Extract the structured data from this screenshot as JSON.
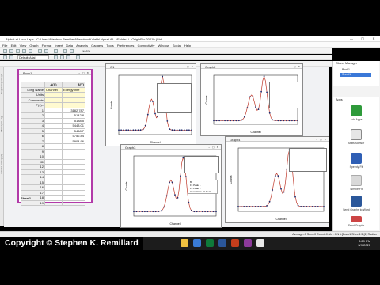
{
  "window": {
    "title": "Alphat at Luna Lapx - C:\\Users\\Stephen Remillard\\Dropbox\\Kolakh\\Alphat.Al\\ - /Folder1/ - OriginPro 2021b (Std)",
    "minimize": "—",
    "maximize": "▢",
    "close": "✕"
  },
  "menu": [
    "File",
    "Edit",
    "View",
    "Graph",
    "Format",
    "Insert",
    "Data",
    "Analysis",
    "Gadgets",
    "Tools",
    "Preferences",
    "Connectivity",
    "Window",
    "Social",
    "Help"
  ],
  "toolbar": {
    "font_label": "Default: Arial",
    "zoom": "100%"
  },
  "left_dock": [
    "Project Explorer (1)",
    "Messages Log",
    "Smart Hint Log (1)"
  ],
  "workbook": {
    "name": "Book1",
    "sheet_tab": "Sheet1",
    "columns": [
      {
        "name": "A(X)"
      },
      {
        "name": "B(Y)"
      }
    ],
    "header_rows": [
      {
        "label": "Long Name",
        "a": "Channel",
        "b": "Energy Inte"
      },
      {
        "label": "Units",
        "a": "",
        "b": ""
      },
      {
        "label": "Comments",
        "a": "",
        "b": ""
      },
      {
        "label": "F(x)=",
        "a": "",
        "b": ""
      }
    ],
    "rows": [
      {
        "n": "1",
        "a": "",
        "b": "3182.787"
      },
      {
        "n": "2",
        "a": "",
        "b": "5142.8"
      },
      {
        "n": "3",
        "a": "",
        "b": "5188.5"
      },
      {
        "n": "4",
        "a": "",
        "b": "5443.01"
      },
      {
        "n": "5",
        "a": "",
        "b": "5468.7"
      },
      {
        "n": "6",
        "a": "",
        "b": "5752.84"
      },
      {
        "n": "7",
        "a": "",
        "b": "5904.96"
      },
      {
        "n": "8",
        "a": "",
        "b": ""
      },
      {
        "n": "9",
        "a": "",
        "b": ""
      },
      {
        "n": "10",
        "a": "",
        "b": ""
      },
      {
        "n": "11",
        "a": "",
        "b": ""
      },
      {
        "n": "12",
        "a": "",
        "b": ""
      },
      {
        "n": "13",
        "a": "",
        "b": ""
      },
      {
        "n": "14",
        "a": "",
        "b": ""
      },
      {
        "n": "15",
        "a": "",
        "b": ""
      },
      {
        "n": "16",
        "a": "",
        "b": ""
      },
      {
        "n": "17",
        "a": "",
        "b": ""
      },
      {
        "n": "18",
        "a": "",
        "b": ""
      },
      {
        "n": "19",
        "a": "",
        "b": ""
      }
    ]
  },
  "graphs": [
    {
      "name": "G1",
      "xlabel": "Channel",
      "ylabel": "Counts",
      "color": "#c0392b"
    },
    {
      "name": "Graph2",
      "xlabel": "Channel",
      "ylabel": "Counts",
      "color": "#2c3e9b"
    },
    {
      "name": "Graph3",
      "xlabel": "Channel",
      "ylabel": "Counts",
      "color": "#2c3e9b",
      "legend": [
        "B",
        "Fit Peak 1",
        "Fit Peak 2",
        "Cumulative Fit Peak"
      ]
    },
    {
      "name": "Graph4",
      "xlabel": "Channel",
      "ylabel": "Counts",
      "color": "#2c3e9b"
    }
  ],
  "object_manager": {
    "title": "Object Manager",
    "items": [
      "Book1",
      "Sheet1"
    ]
  },
  "apps": {
    "title": "Apps",
    "items": [
      "Add Apps",
      "Stats Advisor",
      "Speedy Fit",
      "Simple Fit",
      "Send Graphs to Word",
      "Send Graphs"
    ]
  },
  "status": {
    "text": "Average=0 Sum=0 Count=0  AU : ON  1:[Book1]Sheet1!1:[1] Radian"
  },
  "clock": {
    "time": "8:29 PM",
    "date": "3/9/2021"
  },
  "copyright": "Copyright © Stephen K. Remillard",
  "colors": {
    "workbook_border": "#b23aa8",
    "peak_fit": "#c0392b",
    "data_points": "#1a2a6c"
  }
}
